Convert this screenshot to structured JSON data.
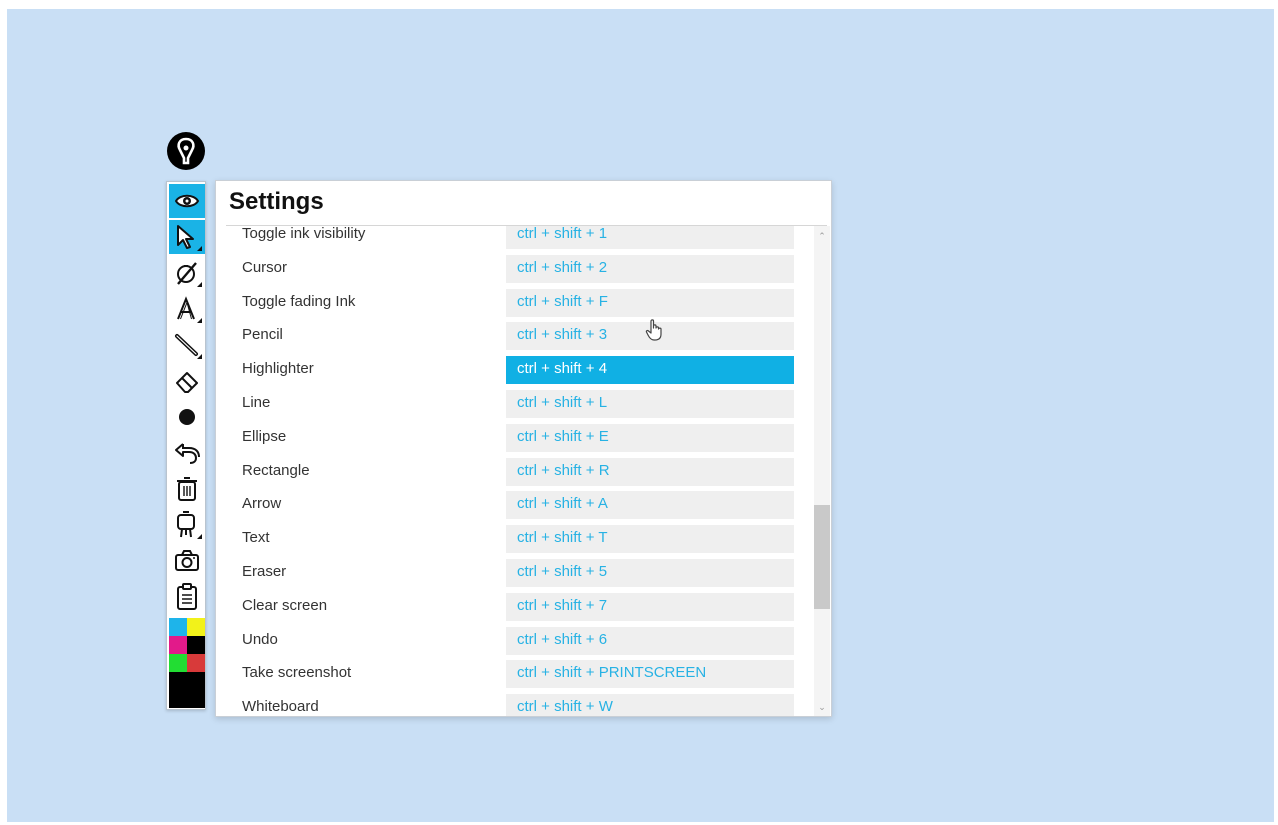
{
  "panel": {
    "title": "Settings"
  },
  "shortcuts": [
    {
      "action": "Toggle ink visibility",
      "keys": "ctrl + shift + 1"
    },
    {
      "action": "Cursor",
      "keys": "ctrl + shift + 2"
    },
    {
      "action": "Toggle fading Ink",
      "keys": "ctrl + shift + F"
    },
    {
      "action": "Pencil",
      "keys": "ctrl + shift + 3"
    },
    {
      "action": "Highlighter",
      "keys": "ctrl + shift + 4",
      "selected": true
    },
    {
      "action": "Line",
      "keys": "ctrl + shift + L"
    },
    {
      "action": "Ellipse",
      "keys": "ctrl + shift + E"
    },
    {
      "action": "Rectangle",
      "keys": "ctrl + shift + R"
    },
    {
      "action": "Arrow",
      "keys": "ctrl + shift + A"
    },
    {
      "action": "Text",
      "keys": "ctrl + shift + T"
    },
    {
      "action": "Eraser",
      "keys": "ctrl + shift + 5"
    },
    {
      "action": "Clear screen",
      "keys": "ctrl + shift + 7"
    },
    {
      "action": "Undo",
      "keys": "ctrl + shift + 6"
    },
    {
      "action": "Take screenshot",
      "keys": "ctrl + shift + PRINTSCREEN"
    },
    {
      "action": "Whiteboard",
      "keys": "ctrl + shift + W"
    }
  ],
  "toolbar": {
    "tools": [
      {
        "icon": "eye-icon",
        "active": true
      },
      {
        "icon": "cursor-arrow-icon",
        "active": true
      },
      {
        "icon": "pen-hidden-icon"
      },
      {
        "icon": "text-tool-icon"
      },
      {
        "icon": "line-tool-icon"
      },
      {
        "icon": "eraser-icon"
      },
      {
        "icon": "brush-size-dot-icon"
      },
      {
        "icon": "undo-icon"
      },
      {
        "icon": "trash-icon"
      },
      {
        "icon": "whiteboard-easel-icon"
      },
      {
        "icon": "screenshot-camera-icon"
      },
      {
        "icon": "clipboard-icon"
      }
    ],
    "colors": [
      "#1eb4ea",
      "#f2f21a",
      "#e21a8a",
      "#000000",
      "#22dd33",
      "#d83a3a",
      "#000000"
    ]
  },
  "colors": {
    "accent": "#10b0e4",
    "desktop_background": "#c9dff5"
  }
}
